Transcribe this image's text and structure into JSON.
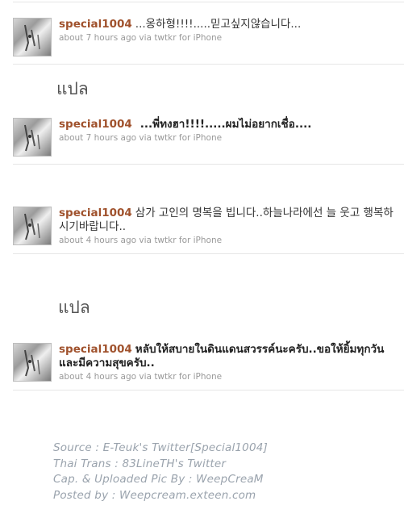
{
  "tweets": [
    {
      "username": "special1004",
      "text": "...옹하형!!!!.....믿고싶지않습니다...",
      "time": "about 7 hours ago",
      "via": "via",
      "client": "twtkr for iPhone"
    },
    {
      "username": "special1004",
      "text": "...พี่ทงฮา!!!!.....ผมไม่อยากเชื่อ....",
      "time": "about 7 hours ago",
      "via": "via",
      "client": "twtkr for iPhone"
    },
    {
      "username": "special1004",
      "text": "삼가 고인의 명복을 빕니다..하늘나라에선 늘 웃고 행복하시기바랍니다..",
      "time": "about 4 hours ago",
      "via": "via",
      "client": "twtkr for iPhone"
    },
    {
      "username": "special1004",
      "text": "หลับให้สบายในดินแดนสวรรค์นะครับ..ขอให้ยิ้มทุกวันและมีความสุขครับ..",
      "time": "about 4 hours ago",
      "via": "via",
      "client": "twtkr for iPhone"
    }
  ],
  "translate_labels": [
    "แปล",
    "แปล"
  ],
  "credits": [
    "Source : E-Teuk's Twitter[Special1004]",
    "Thai Trans : 83LineTH's Twitter",
    "Cap. & Uploaded Pic By : WeepCreaM",
    "Posted by : Weepcream.exteen.com"
  ]
}
